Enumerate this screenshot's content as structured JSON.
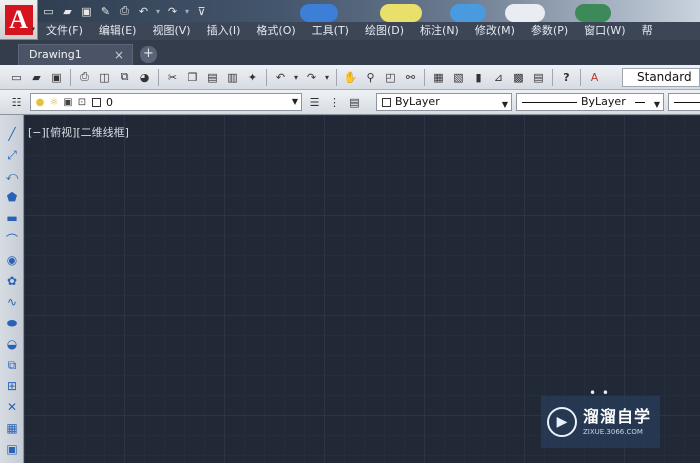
{
  "app": {
    "logo_letter": "A",
    "brand_color": "#d4141f"
  },
  "quick_access": {
    "icons": [
      "new-file-icon",
      "open-folder-icon",
      "save-icon",
      "save-as-icon",
      "print-icon",
      "undo-icon",
      "redo-icon",
      "customize-dropdown-icon"
    ]
  },
  "menubar": {
    "items": [
      "文件(F)",
      "编辑(E)",
      "视图(V)",
      "插入(I)",
      "格式(O)",
      "工具(T)",
      "绘图(D)",
      "标注(N)",
      "修改(M)",
      "参数(P)",
      "窗口(W)",
      "帮"
    ]
  },
  "tabs": {
    "document": "Drawing1",
    "close_glyph": "×",
    "new_tab_glyph": "+"
  },
  "standard_toolbar": {
    "text_style_value": "Standard"
  },
  "layers_toolbar": {
    "current_layer": "0",
    "color": "ByLayer",
    "linetype": "ByLayer"
  },
  "canvas": {
    "viewport_label": "[−][俯视][二维线框]",
    "background": "#212836"
  },
  "watermark": {
    "title": "溜溜自学",
    "subtitle": "ZIXUE.3066.COM"
  }
}
